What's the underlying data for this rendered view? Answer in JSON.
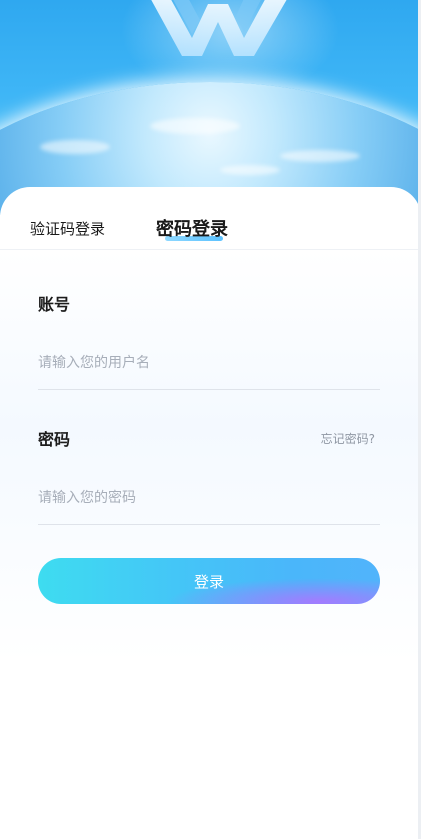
{
  "tabs": {
    "sms_login": "验证码登录",
    "password_login": "密码登录"
  },
  "account": {
    "label": "账号",
    "placeholder": "请输入您的用户名"
  },
  "password": {
    "label": "密码",
    "placeholder": "请输入您的密码",
    "forgot": "忘记密码?"
  },
  "login_button": "登录",
  "colors": {
    "sky": "#3fb6f6",
    "button_start": "#3edcf0",
    "button_end": "#51b4fb",
    "button_accent": "#a878ff"
  },
  "icons": [
    "app-logo"
  ]
}
